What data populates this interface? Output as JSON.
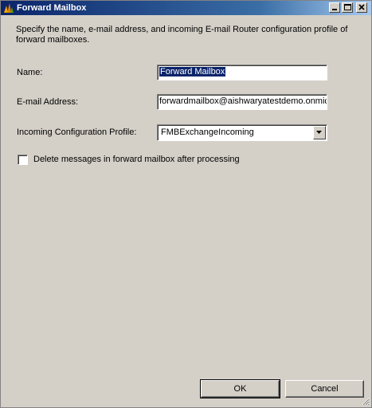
{
  "window": {
    "title": "Forward Mailbox",
    "title_bar_color": "#0a246a",
    "icon": "dynamics-crm-app-icon"
  },
  "description": "Specify the name, e-mail address, and incoming E-mail Router configuration profile of forward mailboxes.",
  "form": {
    "name_label": "Name:",
    "name_value": "Forward Mailbox",
    "email_label": "E-mail Address:",
    "email_value": "forwardmailbox@aishwaryatestdemo.onmicrosoft.com",
    "profile_label": "Incoming Configuration Profile:",
    "profile_value": "FMBExchangeIncoming",
    "delete_checkbox_label": "Delete messages in forward mailbox after processing",
    "delete_checked": false
  },
  "buttons": {
    "ok": "OK",
    "cancel": "Cancel"
  }
}
